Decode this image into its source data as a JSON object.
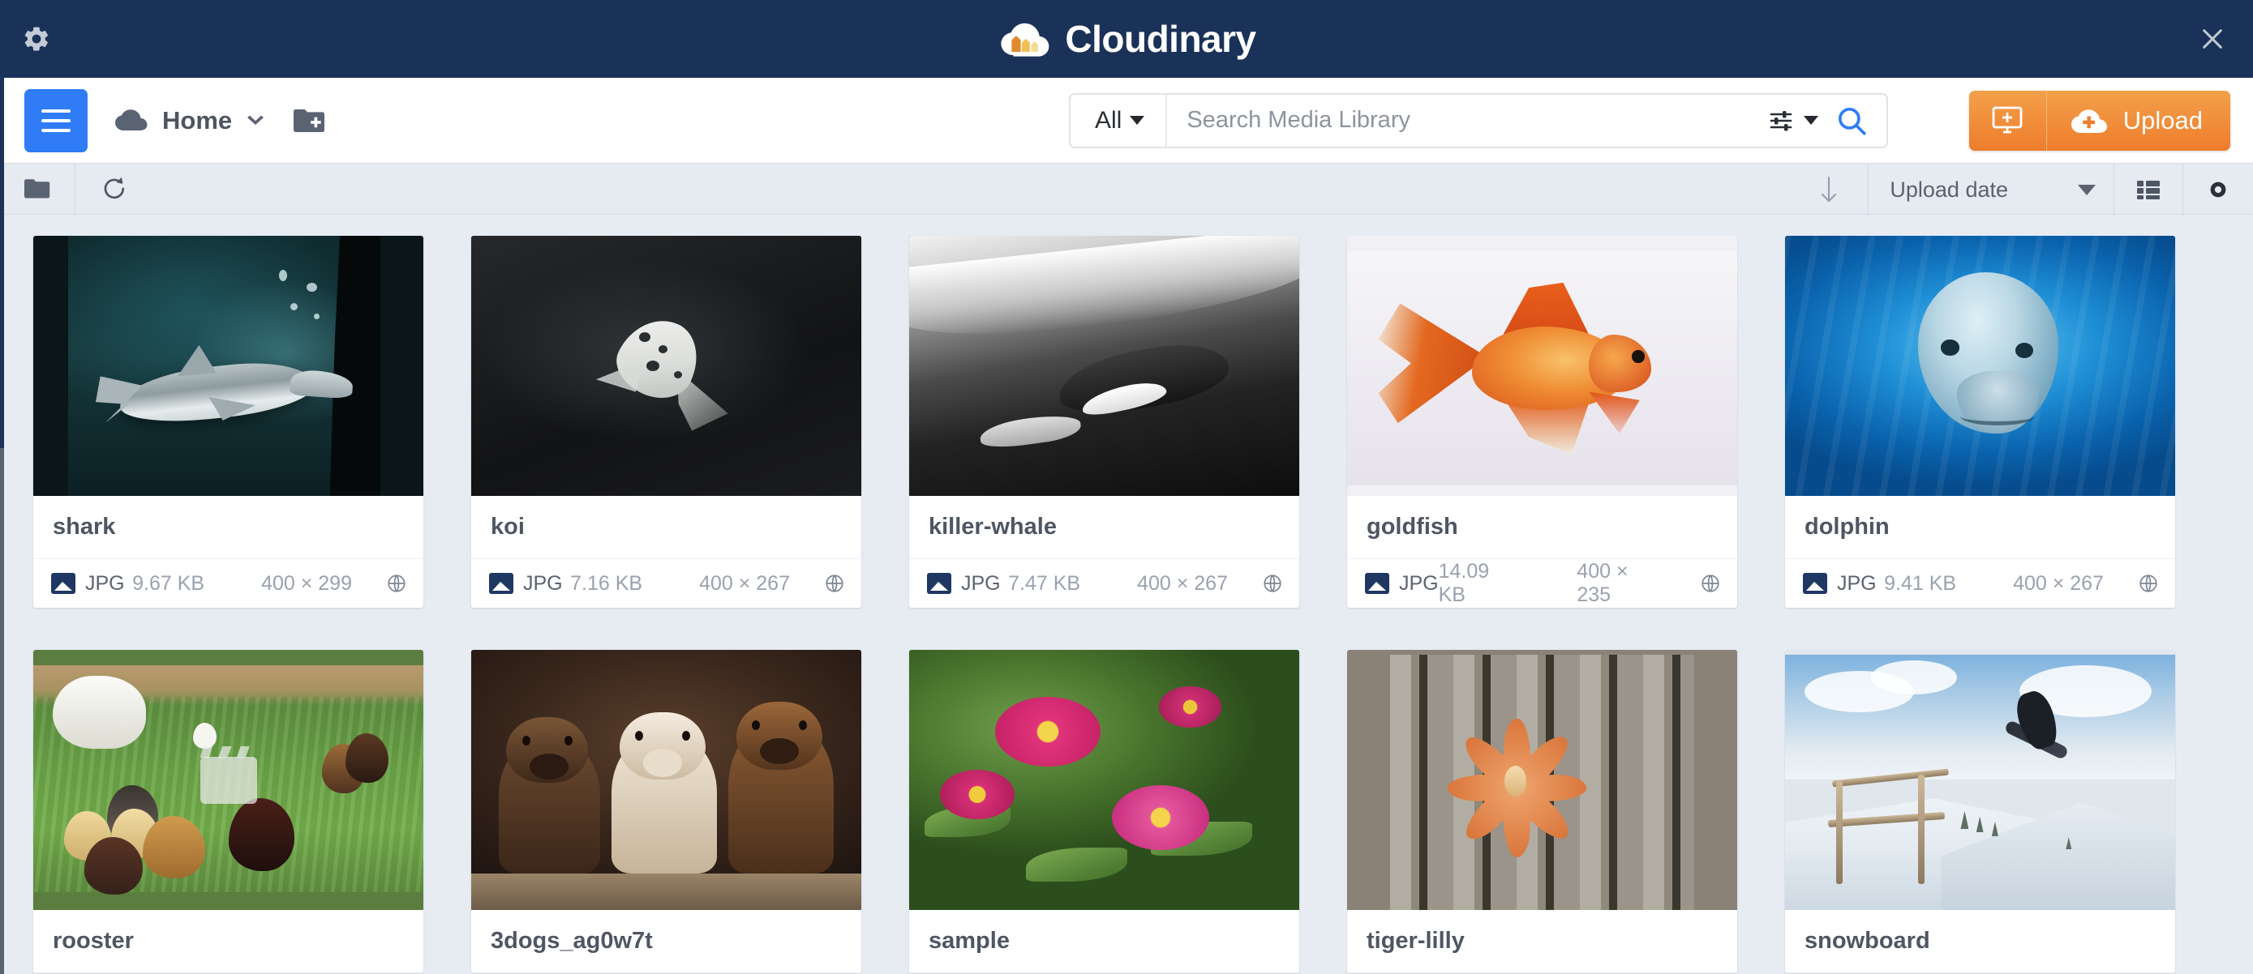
{
  "window": {
    "title": "Cloudinary",
    "brand_name": "Cloudinary",
    "colors": {
      "topbar": "#1a3258",
      "accent_blue": "#2f7cf6",
      "accent_orange": "#ee7d2d",
      "toolbar_bg": "#e6eaf1",
      "page_bg": "#e7ebf2",
      "logo_arrow_1": "#e08b2e",
      "logo_arrow_2": "#f0bf52",
      "logo_arrow_3": "#f3dc93"
    },
    "gear_icon": "gear-icon",
    "close_icon": "close-icon"
  },
  "navbar": {
    "menu_icon": "hamburger-icon",
    "breadcrumb": {
      "cloud_icon": "cloud-icon",
      "label": "Home",
      "chevron_icon": "chevron-down-icon"
    },
    "new_folder_icon": "folder-plus-icon"
  },
  "search": {
    "scope_label": "All",
    "scope_chevron": "caret-down-icon",
    "placeholder": "Search Media Library",
    "value": "",
    "advanced_icon": "filter-sliders-icon",
    "advanced_chevron": "caret-down-icon",
    "search_icon": "search-icon"
  },
  "upload": {
    "create_icon": "monitor-plus-icon",
    "cloud_plus_icon": "cloud-plus-icon",
    "label": "Upload"
  },
  "toolbar": {
    "folder_icon": "folder-icon",
    "refresh_icon": "refresh-icon",
    "sort_direction_icon": "arrow-down-icon",
    "sort_label": "Upload date",
    "sort_chevron": "caret-down-icon",
    "list_view_icon": "list-view-icon",
    "preview_icon": "eye-icon"
  },
  "grid": {
    "columns": 5,
    "assets": [
      {
        "title": "shark",
        "format": "JPG",
        "size": "9.67 KB",
        "dimensions": "400 × 299",
        "access_icon": "globe-icon",
        "type_icon": "image-icon",
        "thumb": "shark"
      },
      {
        "title": "koi",
        "format": "JPG",
        "size": "7.16 KB",
        "dimensions": "400 × 267",
        "access_icon": "globe-icon",
        "type_icon": "image-icon",
        "thumb": "koi"
      },
      {
        "title": "killer-whale",
        "format": "JPG",
        "size": "7.47 KB",
        "dimensions": "400 × 267",
        "access_icon": "globe-icon",
        "type_icon": "image-icon",
        "thumb": "whale"
      },
      {
        "title": "goldfish",
        "format": "JPG",
        "size": "14.09 KB",
        "dimensions": "400 × 235",
        "access_icon": "globe-icon",
        "type_icon": "image-icon",
        "thumb": "goldfish"
      },
      {
        "title": "dolphin",
        "format": "JPG",
        "size": "9.41 KB",
        "dimensions": "400 × 267",
        "access_icon": "globe-icon",
        "type_icon": "image-icon",
        "thumb": "dolphin"
      },
      {
        "title": "rooster",
        "format": "",
        "size": "",
        "dimensions": "",
        "access_icon": "",
        "type_icon": "video-icon",
        "thumb": "rooster"
      },
      {
        "title": "3dogs_ag0w7t",
        "format": "",
        "size": "",
        "dimensions": "",
        "access_icon": "",
        "type_icon": "image-icon",
        "thumb": "dogs"
      },
      {
        "title": "sample",
        "format": "",
        "size": "",
        "dimensions": "",
        "access_icon": "",
        "type_icon": "image-icon",
        "thumb": "sample"
      },
      {
        "title": "tiger-lilly",
        "format": "",
        "size": "",
        "dimensions": "",
        "access_icon": "",
        "type_icon": "image-icon",
        "thumb": "tiger"
      },
      {
        "title": "snowboard",
        "format": "",
        "size": "",
        "dimensions": "",
        "access_icon": "",
        "type_icon": "image-icon",
        "thumb": "snow"
      }
    ]
  }
}
